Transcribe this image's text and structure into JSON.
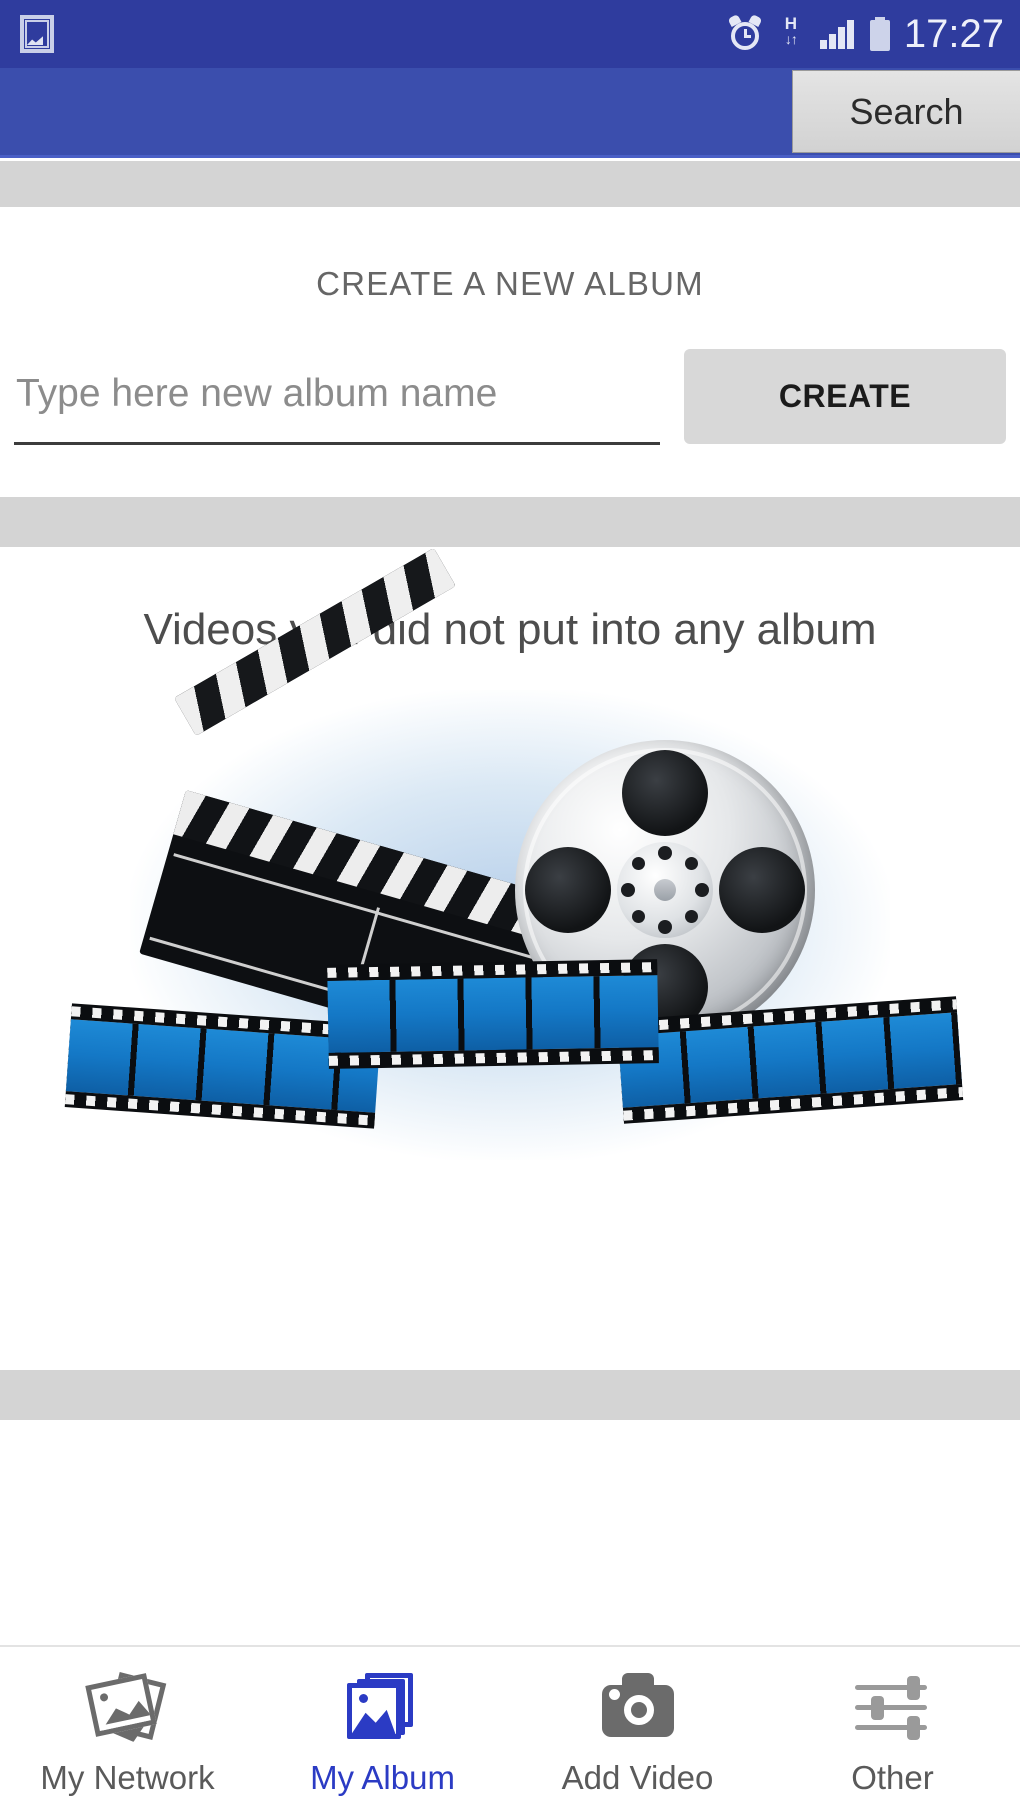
{
  "status_bar": {
    "time": "17:27",
    "notification_icon": "gallery-image-icon",
    "alarm_icon": "alarm-clock-icon",
    "network_type": "H",
    "data_arrows": "↓↑",
    "signal_icon": "signal-bars-icon",
    "battery_icon": "battery-full-icon",
    "background_color": "#2f3c9e"
  },
  "app_bar": {
    "search_label": "Search",
    "background_color": "#3b4ead"
  },
  "create_album": {
    "section_title": "CREATE A NEW ALBUM",
    "input_placeholder": "Type here new album name",
    "input_value": "",
    "create_label": "CREATE"
  },
  "videos_section": {
    "title": "Videos you did not put into any album",
    "thumbnail_name": "film-clapperboard-reel-thumbnail"
  },
  "bottom_nav": {
    "active_color": "#2b3bc4",
    "inactive_color": "#5a5a5a",
    "items": [
      {
        "label": "My Network",
        "icon": "stacked-photos-icon",
        "active": false
      },
      {
        "label": "My Album",
        "icon": "photo-album-icon",
        "active": true
      },
      {
        "label": "Add Video",
        "icon": "camera-icon",
        "active": false
      },
      {
        "label": "Other",
        "icon": "sliders-icon",
        "active": false
      }
    ]
  },
  "bands": {
    "color": "#d4d4d4"
  }
}
